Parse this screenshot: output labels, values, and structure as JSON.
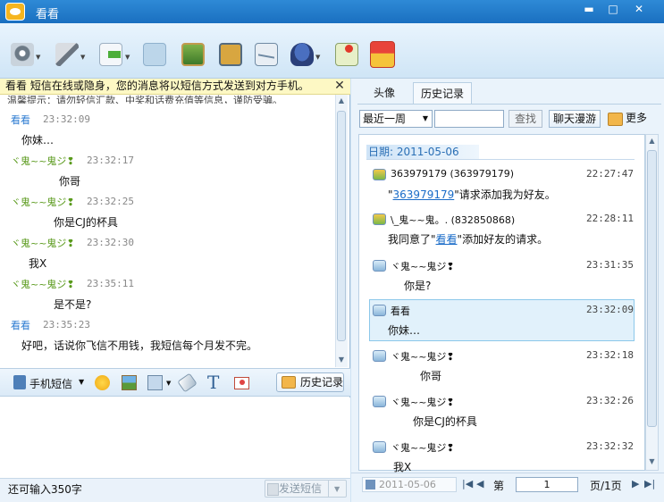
{
  "window": {
    "title": "看看"
  },
  "toolbar": {
    "icons": [
      "webcam-icon",
      "microphone-icon",
      "file-transfer-icon",
      "screen-share-icon",
      "picture-frame-icon",
      "mobile-icon",
      "email-icon",
      "police-hat-icon",
      "map-icon",
      "gift-icon"
    ]
  },
  "notice": {
    "text": "看看 短信在线或隐身，您的消息将以短信方式发送到对方手机。",
    "close": "✕",
    "tip": "温馨提示：请勿轻信汇款、中奖和话费充值等信息，谨防受骗。"
  },
  "chat": {
    "messages": [
      {
        "name": "看看",
        "time": "23:32:09",
        "text": "你妹…",
        "self": true
      },
      {
        "name": "ヾ鬼~~鬼ジ❢",
        "time": "23:32:17",
        "text": "你哥",
        "self": false
      },
      {
        "name": "ヾ鬼~~鬼ジ❢",
        "time": "23:32:25",
        "text": "你是CJ的杯具",
        "self": false
      },
      {
        "name": "ヾ鬼~~鬼ジ❢",
        "time": "23:32:30",
        "text": "我X",
        "self": false
      },
      {
        "name": "ヾ鬼~~鬼ジ❢",
        "time": "23:35:11",
        "text": "是不是?",
        "self": false
      },
      {
        "name": "看看",
        "time": "23:35:23",
        "text": "好吧，话说你飞信不用钱，我短信每个月发不完。",
        "self": true
      }
    ]
  },
  "input_toolbar": {
    "sms_label": "手机短信",
    "history_label": "历史记录"
  },
  "input": {
    "remaining": "还可输入350字",
    "send_label": "发送短信"
  },
  "right": {
    "tabs": [
      "头像",
      "历史记录"
    ],
    "period": "最近一周",
    "find_label": "查找",
    "roam_label": "聊天漫游",
    "more_label": "更多",
    "date_header": "日期: 2011-05-06",
    "records": [
      {
        "name": "363979179 (363979179)",
        "time": "22:27:47",
        "text_pre": "\"",
        "link": "363979179",
        "text_post": "\"请求添加我为好友。"
      },
      {
        "name": "\\_鬼~~鬼。. (832850868)",
        "time": "22:28:11",
        "text_pre": "我同意了\"",
        "link": "看看",
        "text_post": "\"添加好友的请求。"
      },
      {
        "name": "ヾ鬼~~鬼ジ❢",
        "time": "23:31:35",
        "text": "你是?"
      },
      {
        "name": "看看",
        "time": "23:32:09",
        "text": "你妹…"
      },
      {
        "name": "ヾ鬼~~鬼ジ❢",
        "time": "23:32:18",
        "text": "你哥"
      },
      {
        "name": "ヾ鬼~~鬼ジ❢",
        "time": "23:32:26",
        "text": "你是CJ的杯具"
      },
      {
        "name": "ヾ鬼~~鬼ジ❢",
        "time": "23:32:32",
        "text": "我X"
      }
    ],
    "pager": {
      "date": "2011-05-06",
      "page_prefix": "第",
      "page": "1",
      "page_suffix": "页/1页"
    }
  },
  "colors": {
    "self_name": "#2a7ad0",
    "other_name": "#5a9a1c",
    "link": "#1a6cc8"
  }
}
